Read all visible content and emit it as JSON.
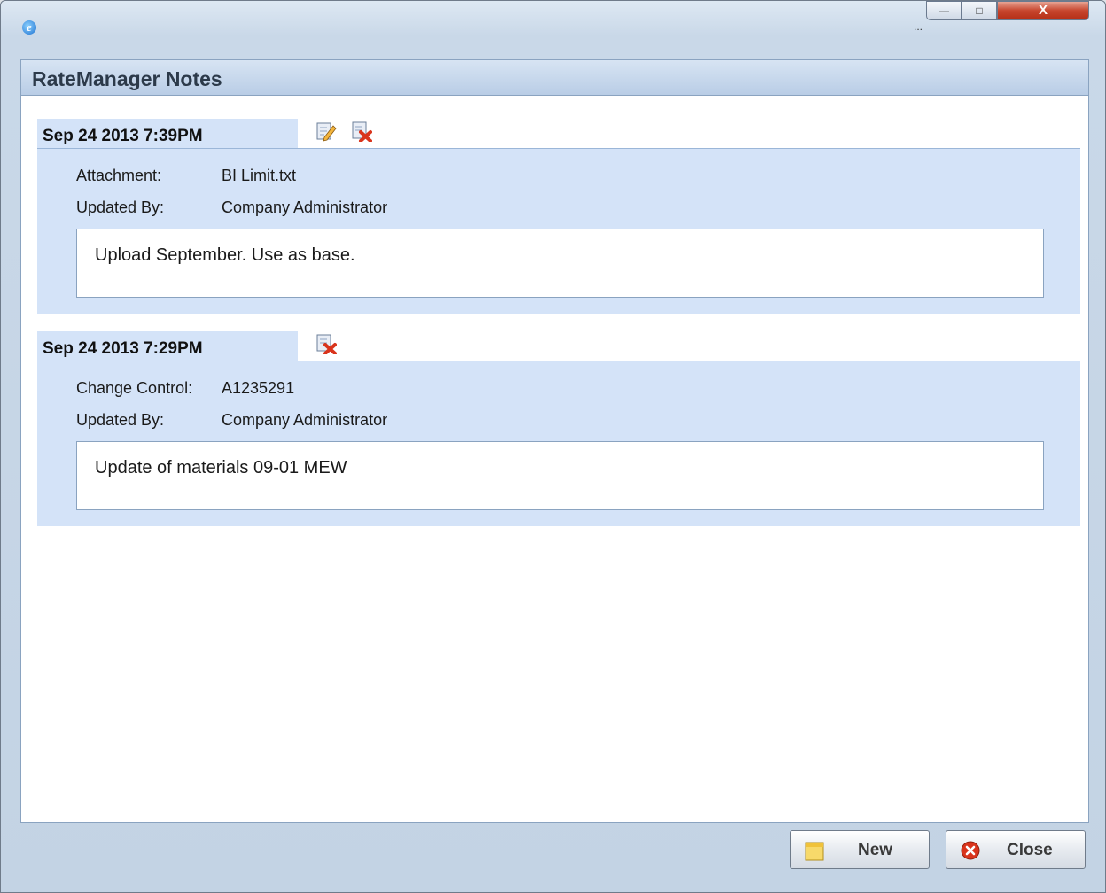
{
  "window": {
    "title_icon": "ie-icon",
    "extra_menu": "...",
    "minimize_symbol": "—",
    "maximize_symbol": "□",
    "close_symbol": "X"
  },
  "dialog": {
    "title": "RateManager Notes"
  },
  "notes": [
    {
      "timestamp": "Sep 24 2013 7:39PM",
      "icons": [
        "edit-note-icon",
        "delete-note-icon"
      ],
      "fields": [
        {
          "label": "Attachment:",
          "value": "BI Limit.txt"
        },
        {
          "label": "Updated By:",
          "value": "Company Administrator"
        }
      ],
      "text": "Upload September. Use as base."
    },
    {
      "timestamp": "Sep 24 2013 7:29PM",
      "icons": [
        "delete-note-icon"
      ],
      "fields": [
        {
          "label": "Change Control:",
          "value": "A1235291"
        },
        {
          "label": "Updated By:",
          "value": "Company Administrator"
        }
      ],
      "text": "Update of materials 09-01 MEW"
    }
  ],
  "footer": {
    "new_label": "New",
    "close_label": "Close"
  },
  "colors": {
    "note_background": "#d4e3f8",
    "header_gradient_top": "#d7e4f3",
    "close_icon_red": "#d9341c"
  }
}
